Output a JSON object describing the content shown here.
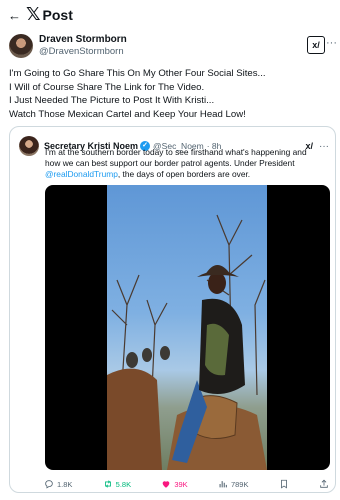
{
  "header": {
    "back_icon": "arrow-left-icon",
    "brand": "𝕏",
    "title": "Post"
  },
  "post": {
    "display_name": "Draven Stormborn",
    "handle": "@DravenStormborn",
    "grok_label": "x/",
    "more": "···",
    "text_lines": [
      "I'm Going to Go Share This On My Other Four Social Sites...",
      "I Will of Course Share The Link for The Video.",
      "I Just Needed The Picture to Post It With Kristi...",
      "Watch Those Mexican Cartel and Keep Your Head Low!"
    ]
  },
  "quote": {
    "display_name": "Secretary Kristi Noem",
    "verified_icon": "✓",
    "handle": "@Sec_Noem",
    "time": "· 8h",
    "grok_label": "x/",
    "more": "···",
    "text_before": "I'm at the southern border today to see firsthand what's happening and how we can best support our border patrol agents. Under President ",
    "mention": "@realDonaldTrump",
    "text_after": ", the days of open borders are over."
  },
  "actions": {
    "replies": "1.8K",
    "reposts": "5.8K",
    "likes": "39K",
    "views": "789K"
  },
  "colors": {
    "accent": "#1d9bf0",
    "repost": "#00ba7c",
    "like": "#f91880",
    "muted": "#536471"
  }
}
